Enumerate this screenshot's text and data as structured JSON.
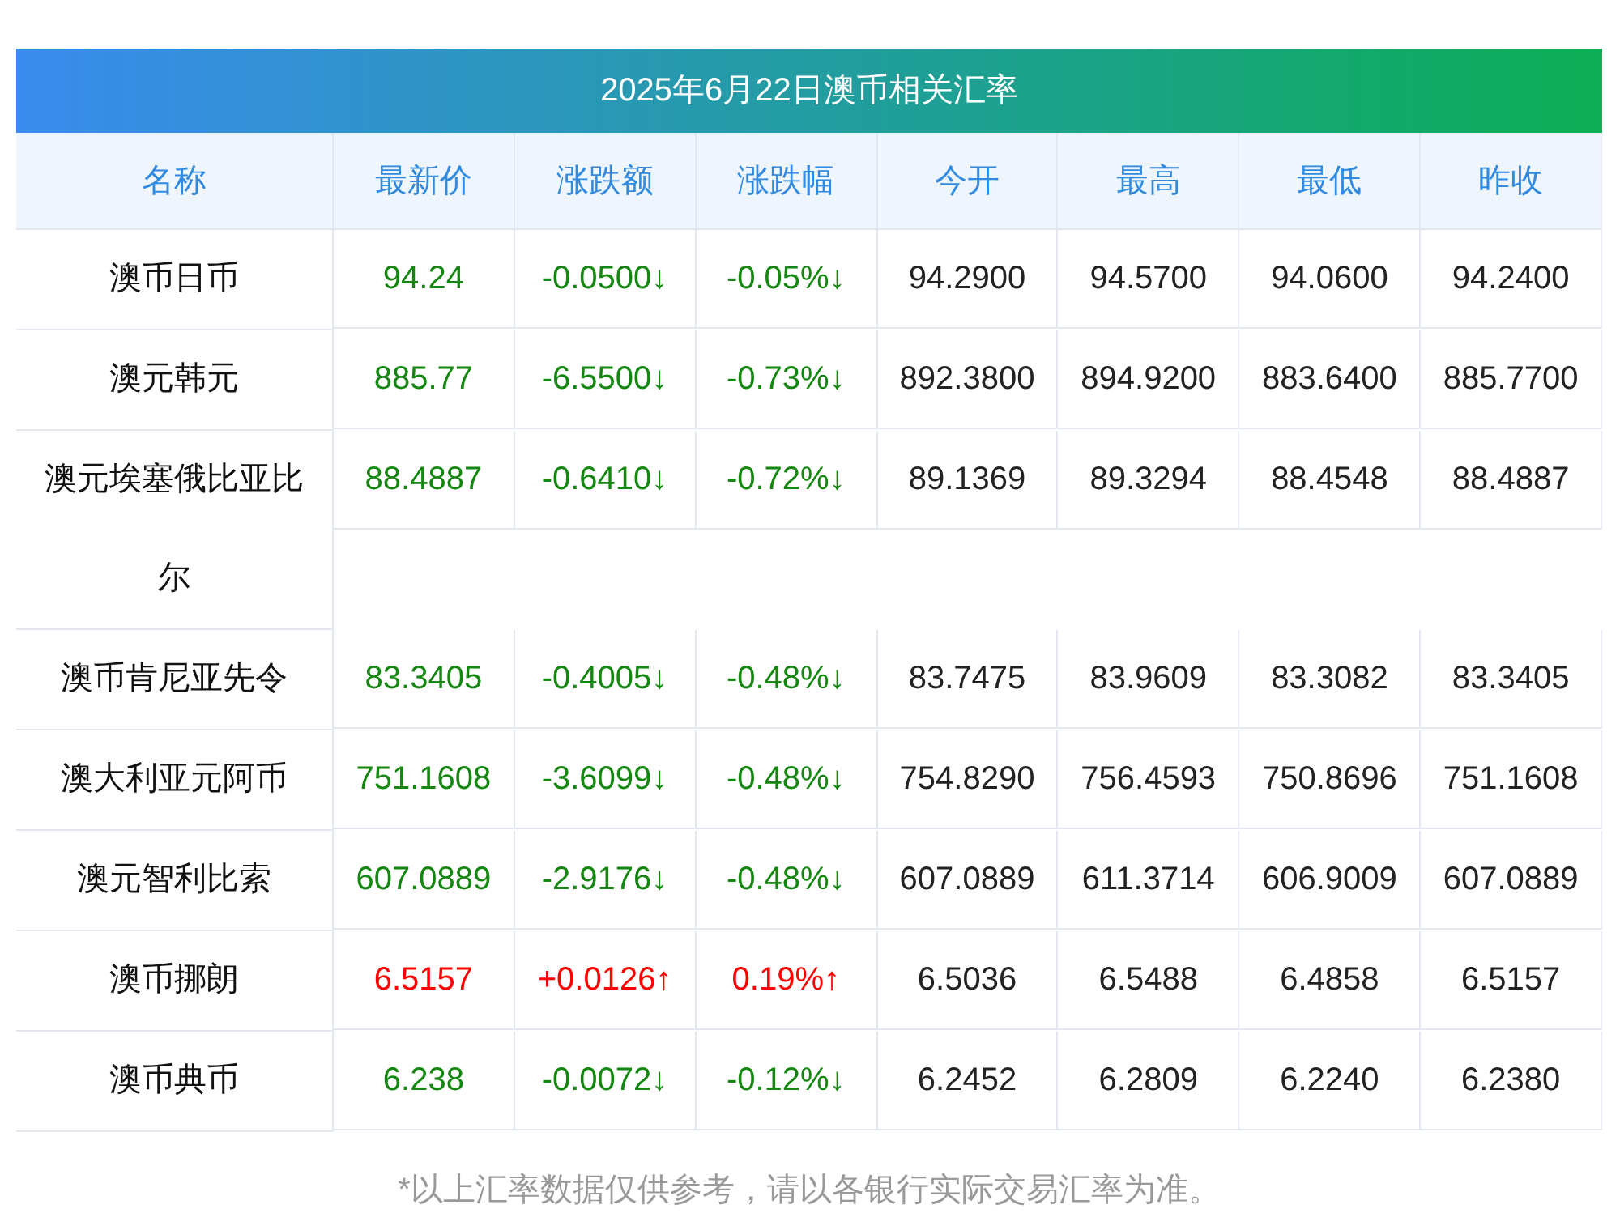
{
  "title": "2025年6月22日澳币相关汇率",
  "columns": [
    "名称",
    "最新价",
    "涨跌额",
    "涨跌幅",
    "今开",
    "最高",
    "最低",
    "昨收"
  ],
  "rows": [
    {
      "name": "澳币日币",
      "rising": false,
      "cells": [
        "94.24",
        "-0.0500↓",
        "-0.05%↓",
        "94.2900",
        "94.5700",
        "94.0600",
        "94.2400"
      ]
    },
    {
      "name": "澳元韩元",
      "rising": false,
      "cells": [
        "885.77",
        "-6.5500↓",
        "-0.73%↓",
        "892.3800",
        "894.9200",
        "883.6400",
        "885.7700"
      ]
    },
    {
      "name": "澳元埃塞俄比亚比尔",
      "rising": false,
      "cells": [
        "88.4887",
        "-0.6410↓",
        "-0.72%↓",
        "89.1369",
        "89.3294",
        "88.4548",
        "88.4887"
      ]
    },
    {
      "name": "澳币肯尼亚先令",
      "rising": false,
      "cells": [
        "83.3405",
        "-0.4005↓",
        "-0.48%↓",
        "83.7475",
        "83.9609",
        "83.3082",
        "83.3405"
      ]
    },
    {
      "name": "澳大利亚元阿币",
      "rising": false,
      "cells": [
        "751.1608",
        "-3.6099↓",
        "-0.48%↓",
        "754.8290",
        "756.4593",
        "750.8696",
        "751.1608"
      ]
    },
    {
      "name": "澳元智利比索",
      "rising": false,
      "cells": [
        "607.0889",
        "-2.9176↓",
        "-0.48%↓",
        "607.0889",
        "611.3714",
        "606.9009",
        "607.0889"
      ]
    },
    {
      "name": "澳币挪朗",
      "rising": true,
      "cells": [
        "6.5157",
        "+0.0126↑",
        "0.19%↑",
        "6.5036",
        "6.5488",
        "6.4858",
        "6.5157"
      ]
    },
    {
      "name": "澳币典币",
      "rising": false,
      "cells": [
        "6.238",
        "-0.0072↓",
        "-0.12%↓",
        "6.2452",
        "6.2809",
        "6.2240",
        "6.2380"
      ]
    }
  ],
  "footnote": "*以上汇率数据仅供参考，请以各银行实际交易汇率为准。"
}
